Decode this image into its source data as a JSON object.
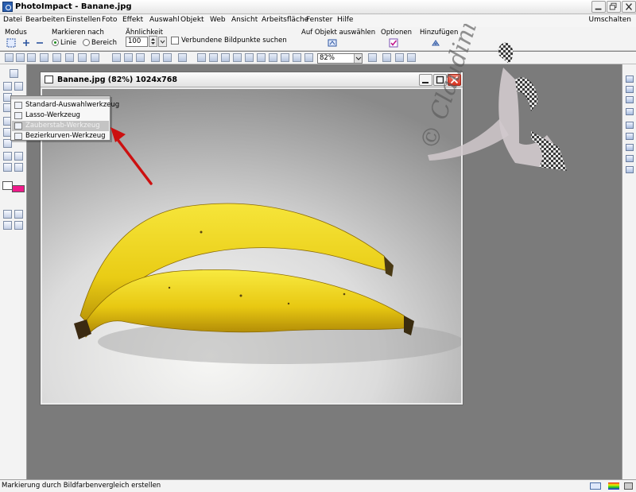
{
  "window": {
    "title": "PhotoImpact - Banane.jpg"
  },
  "menu": {
    "items": [
      "Datei",
      "Bearbeiten",
      "Einstellen",
      "Foto",
      "Effekt",
      "Auswahl",
      "Objekt",
      "Web",
      "Ansicht",
      "Arbeitsfläche",
      "Fenster",
      "Hilfe"
    ],
    "right_label": "Umschalten"
  },
  "attrbar": {
    "modus_label": "Modus",
    "markieren_label": "Markieren nach",
    "option_linie": "Linie",
    "option_bereich": "Bereich",
    "aehnlichkeit_label": "Ähnlichkeit",
    "aehnlichkeit_value": "100",
    "verbundene_label": "Verbundene Bildpunkte suchen",
    "auf_objekt_label": "Auf Objekt auswählen",
    "optionen_label": "Optionen",
    "hinzufuegen_label": "Hinzufügen"
  },
  "stdbar": {
    "zoom": "82%"
  },
  "document": {
    "title": "Banane.jpg (82%) 1024x768"
  },
  "popup": {
    "items": [
      {
        "label": "Standard-Auswahlwerkzeug",
        "icon": "rect-select-icon"
      },
      {
        "label": "Lasso-Werkzeug",
        "icon": "lasso-icon"
      },
      {
        "label": "Zauberstab-Werkzeug",
        "icon": "magic-wand-icon",
        "selected": true
      },
      {
        "label": "Bezierkurven-Werkzeug",
        "icon": "bezier-icon"
      }
    ]
  },
  "watermark": {
    "text": "© Claudinia"
  },
  "colors": {
    "foreground": "#ffffff",
    "background": "#ef1a8a",
    "arrow": "#cc1010"
  },
  "status": {
    "text": "Markierung durch Bildfarbenvergleich erstellen"
  }
}
